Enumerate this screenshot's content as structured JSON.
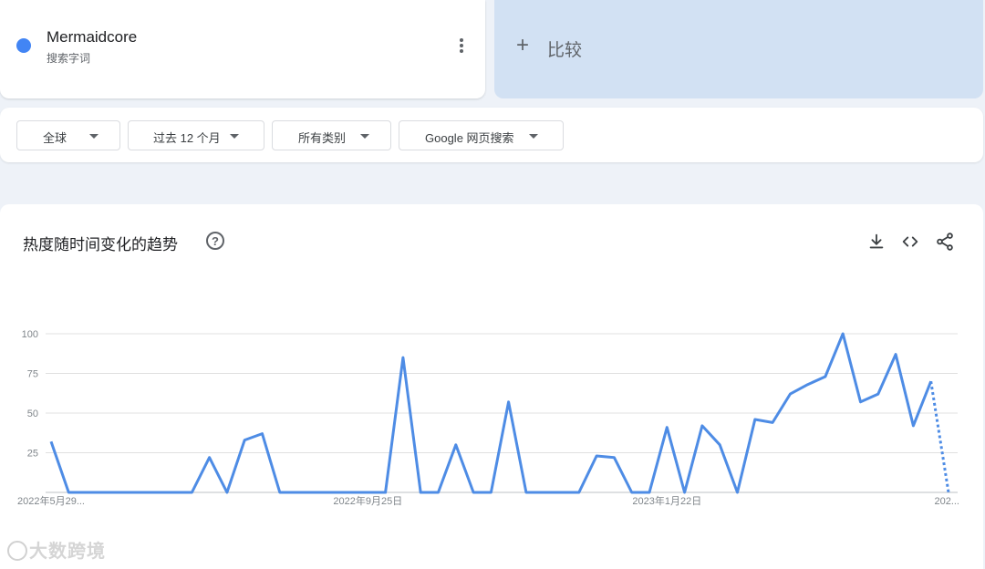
{
  "term": {
    "name": "Mermaidcore",
    "type": "搜索字词",
    "color": "#4285f4",
    "more_icon": "more-vert-icon"
  },
  "compare": {
    "label": "比较",
    "icon": "plus-icon"
  },
  "filters": [
    {
      "label": "全球"
    },
    {
      "label": "过去 12 个月"
    },
    {
      "label": "所有类别"
    },
    {
      "label": "Google 网页搜索"
    }
  ],
  "chart_panel": {
    "title": "热度随时间变化的趋势",
    "help_icon": "help-circle-icon",
    "tools": [
      "download-icon",
      "embed-code-icon",
      "share-icon"
    ]
  },
  "chart_data": {
    "type": "line",
    "series": [
      {
        "values": [
          32,
          0,
          0,
          0,
          0,
          0,
          0,
          0,
          0,
          22,
          0,
          33,
          37,
          0,
          0,
          0,
          0,
          0,
          0,
          0,
          85,
          0,
          0,
          30,
          0,
          0,
          57,
          0,
          0,
          0,
          0,
          23,
          22,
          0,
          0,
          41,
          0,
          42,
          30,
          0,
          46,
          44,
          62,
          68,
          73,
          100,
          57,
          62,
          87,
          42,
          70,
          0
        ],
        "color": "#4e8ce5",
        "partial_from_index": 50
      }
    ],
    "y_ticks": [
      100,
      75,
      50,
      25
    ],
    "ylim": [
      0,
      100
    ],
    "x_tick_labels": [
      "2022年5月29...",
      "2022年9月25日",
      "2023年1月22日",
      "202..."
    ],
    "x_tick_indices": [
      0,
      18,
      35,
      51
    ],
    "grid": true
  },
  "watermark": "大数跨境"
}
